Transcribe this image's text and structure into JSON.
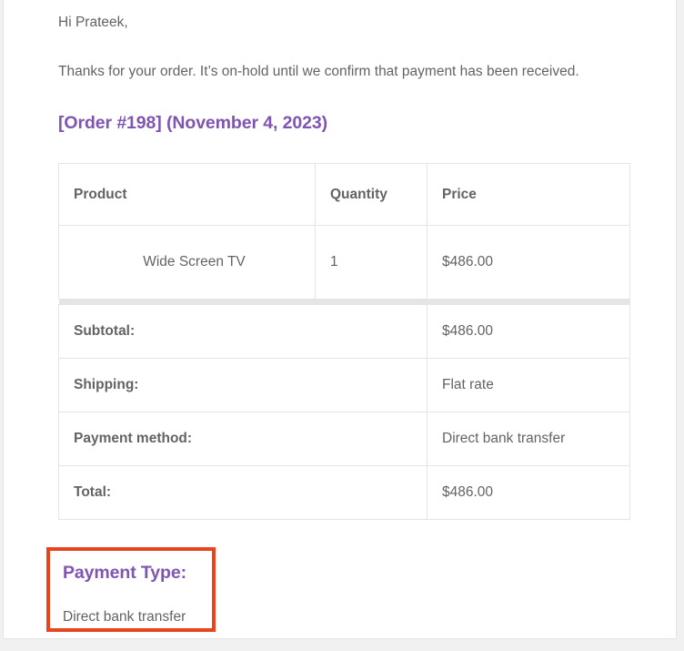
{
  "email": {
    "greeting": "Hi Prateek,",
    "intro": "Thanks for your order. It’s on-hold until we confirm that payment has been received.",
    "order_heading": "[Order #198] (November 4, 2023)",
    "heading_color": "#7f54b3",
    "body_text_color": "#636363"
  },
  "order_table": {
    "columns": [
      "Product",
      "Quantity",
      "Price"
    ],
    "rows": [
      {
        "product": "Wide Screen TV",
        "quantity": "1",
        "price": "$486.00"
      }
    ],
    "footer": [
      {
        "label": "Subtotal:",
        "value": "$486.00"
      },
      {
        "label": "Shipping:",
        "value": "Flat rate"
      },
      {
        "label": "Payment method:",
        "value": "Direct bank transfer"
      },
      {
        "label": "Total:",
        "value": "$486.00"
      }
    ]
  },
  "payment_type_annotation": {
    "title": "Payment Type:",
    "value": "Direct bank transfer",
    "highlight_color": "#e8451e"
  }
}
